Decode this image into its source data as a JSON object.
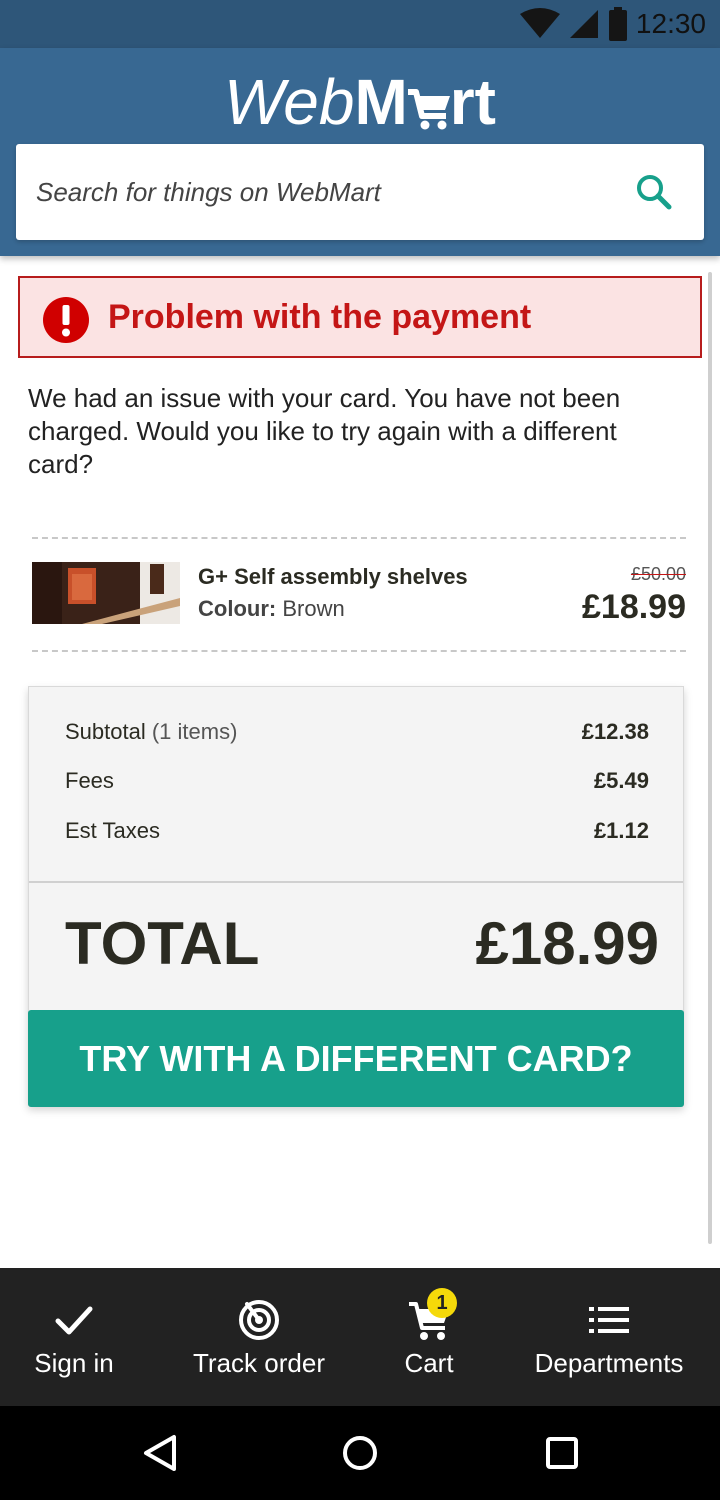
{
  "status_bar": {
    "time": "12:30"
  },
  "header": {
    "logo_web": "Web",
    "logo_m": "M",
    "logo_rt": "rt",
    "search_placeholder": "Search for things on WebMart"
  },
  "alert": {
    "title": "Problem with the payment"
  },
  "message": "We had an issue with your card. You have not been charged. Would you like to try again with a different card?",
  "product": {
    "name": "G+ Self assembly shelves",
    "colour_label": "Colour:",
    "colour_value": "Brown",
    "old_price": "£50.00",
    "price": "£18.99"
  },
  "summary": {
    "subtotal_label": "Subtotal",
    "subtotal_count": "(1 items)",
    "subtotal_value": "£12.38",
    "fees_label": "Fees",
    "fees_value": "£5.49",
    "taxes_label": "Est Taxes",
    "taxes_value": "£1.12",
    "total_label": "TOTAL",
    "total_value": "£18.99",
    "cta_label": "TRY WITH A DIFFERENT CARD?"
  },
  "bottom_nav": {
    "sign_in": "Sign in",
    "track_order": "Track order",
    "cart": "Cart",
    "cart_badge": "1",
    "departments": "Departments"
  },
  "colors": {
    "header": "#386892",
    "status_bar": "#2e5679",
    "alert_red": "#c41616",
    "cta_green": "#17a08b",
    "badge_yellow": "#f5d90a"
  },
  "icons": [
    "wifi-icon",
    "signal-icon",
    "battery-icon",
    "search-icon",
    "alert-icon",
    "check-icon",
    "target-icon",
    "cart-icon",
    "list-icon",
    "back-icon",
    "home-icon",
    "recents-icon"
  ]
}
